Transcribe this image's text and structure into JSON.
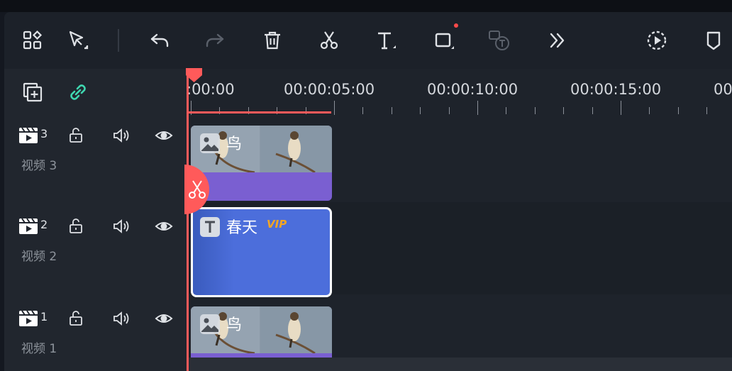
{
  "toolbar": {
    "icons": [
      "layout-grid-icon",
      "select-arrow-icon",
      "undo-icon",
      "redo-icon",
      "delete-icon",
      "scissors-icon",
      "text-icon",
      "crop-icon",
      "text-to-speech-icon",
      "more-icon",
      "render-preview-icon",
      "marker-icon"
    ]
  },
  "sidebar": {
    "add_track_icon": "add-track-icon",
    "link_icon": "link-icon",
    "tracks": [
      {
        "number": "3",
        "label": "视频 3"
      },
      {
        "number": "2",
        "label": "视频 2"
      },
      {
        "number": "1",
        "label": "视频 1"
      }
    ]
  },
  "ruler": {
    "labels": [
      ":00:00",
      "00:00:05:00",
      "00:00:10:00",
      "00:00:15:00",
      "00"
    ]
  },
  "clips": {
    "track3": {
      "title": "鸟",
      "type": "image"
    },
    "track2": {
      "title": "春天",
      "badge": "VIP",
      "type": "text"
    },
    "track1": {
      "title": "鸟",
      "type": "image"
    }
  },
  "colors": {
    "accent": "#ff5a5a",
    "link": "#3fd7b0",
    "clip_purple": "#7a5fd1",
    "text_clip": "#4c6edb",
    "vip": "#f5a623"
  }
}
